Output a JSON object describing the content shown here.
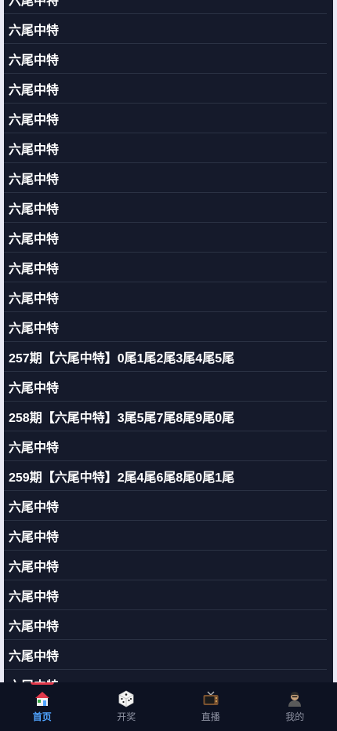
{
  "list": {
    "items": [
      "六尾中特",
      "六尾中特",
      "六尾中特",
      "六尾中特",
      "六尾中特",
      "六尾中特",
      "六尾中特",
      "六尾中特",
      "六尾中特",
      "六尾中特",
      "六尾中特",
      "六尾中特",
      "257期【六尾中特】0尾1尾2尾3尾4尾5尾",
      "六尾中特",
      "258期【六尾中特】3尾5尾7尾8尾9尾0尾",
      "六尾中特",
      "259期【六尾中特】2尾4尾6尾8尾0尾1尾",
      "六尾中特",
      "六尾中特",
      "六尾中特",
      "六尾中特",
      "六尾中特",
      "六尾中特",
      "六尾中特"
    ]
  },
  "tabbar": {
    "tabs": [
      {
        "label": "首页",
        "icon": "home-icon",
        "active": true
      },
      {
        "label": "开奖",
        "icon": "dice-icon",
        "active": false
      },
      {
        "label": "直播",
        "icon": "tv-icon",
        "active": false
      },
      {
        "label": "我的",
        "icon": "user-avatar-icon",
        "active": false
      }
    ]
  },
  "colors": {
    "panel_bg": "#151a2b",
    "tabbar_bg": "#0d1222",
    "active_tab": "#4fa3ff",
    "indicator": "#e2394b",
    "inactive_tab": "#8c90a0"
  }
}
